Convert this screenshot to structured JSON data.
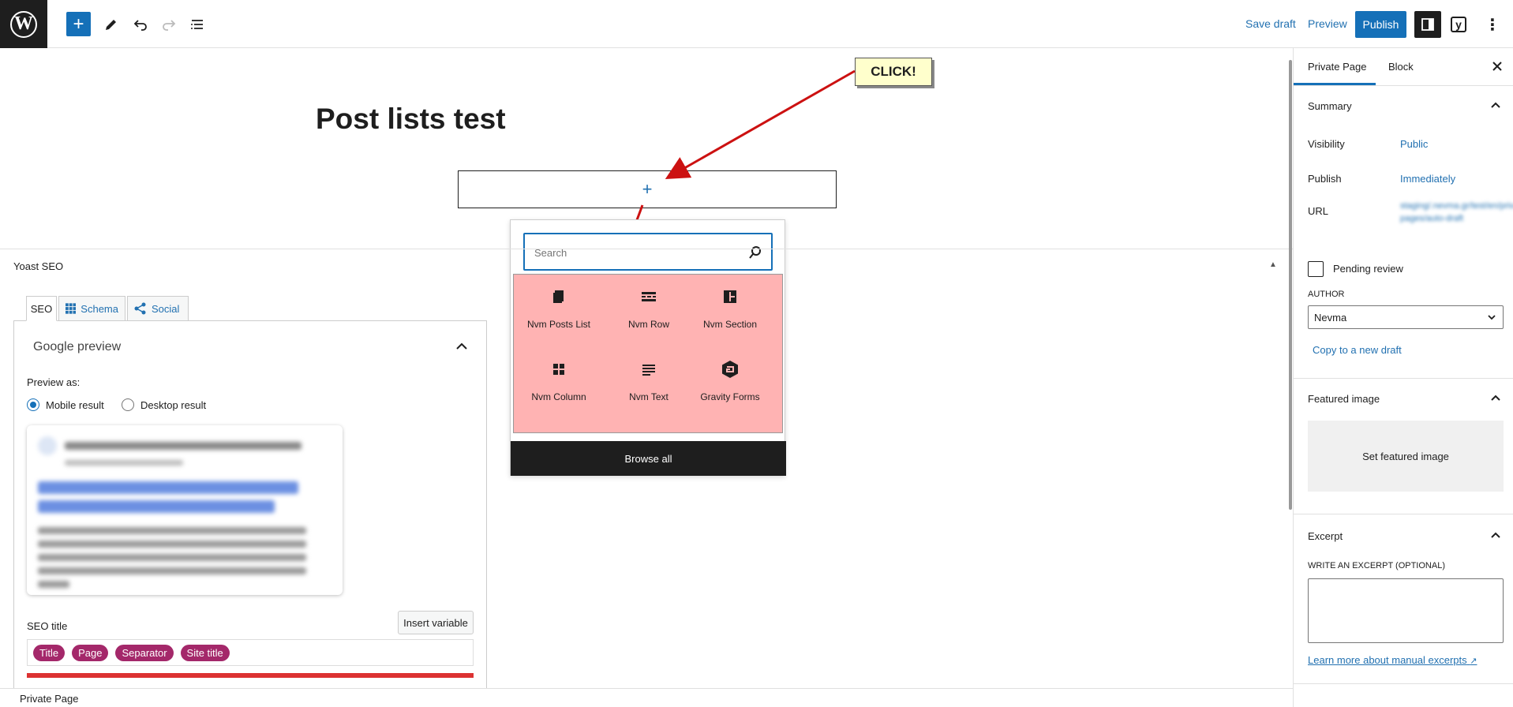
{
  "topbar": {
    "save_draft": "Save draft",
    "preview": "Preview",
    "publish": "Publish",
    "yoast_icon_label": "y",
    "more_icon": "more-vertical-icon",
    "accent_color": "#1570b8"
  },
  "editor": {
    "title": "Post lists test",
    "callout": "CLICK!",
    "appender_icon": "+"
  },
  "inserter": {
    "search_placeholder": "Search",
    "blocks": [
      {
        "label": "Nvm Posts List",
        "icon": "pages-icon"
      },
      {
        "label": "Nvm Row",
        "icon": "row-icon"
      },
      {
        "label": "Nvm Section",
        "icon": "section-icon"
      },
      {
        "label": "Nvm Column",
        "icon": "columns-icon"
      },
      {
        "label": "Nvm Text",
        "icon": "text-icon"
      },
      {
        "label": "Gravity Forms",
        "icon": "gravity-forms-icon"
      }
    ],
    "browse_all": "Browse all",
    "highlight_color": "#ffb3b3"
  },
  "yoast": {
    "title": "Yoast SEO",
    "tabs": [
      "SEO",
      "Schema",
      "Social"
    ],
    "google_preview": "Google preview",
    "preview_as": "Preview as:",
    "radio_mobile": "Mobile result",
    "radio_desktop": "Desktop result",
    "seo_title_label": "SEO title",
    "insert_variable": "Insert variable",
    "pills": [
      "Title",
      "Page",
      "Separator",
      "Site title"
    ],
    "pill_color": "#a4286a",
    "bar_color": "#dc3232"
  },
  "footer": {
    "breadcrumb": "Private Page"
  },
  "sidebar": {
    "tab_page": "Private Page",
    "tab_block": "Block",
    "summary": "Summary",
    "visibility_label": "Visibility",
    "visibility_value": "Public",
    "publish_label": "Publish",
    "publish_value": "Immediately",
    "url_label": "URL",
    "url_value": "staging/.nevma.gr/test/en/private-pages/auto-draft",
    "pending_review": "Pending review",
    "author_label": "AUTHOR",
    "author_value": "Nevma",
    "copy_draft": "Copy to a new draft",
    "featured_image": "Featured image",
    "set_featured": "Set featured image",
    "excerpt": "Excerpt",
    "excerpt_label": "WRITE AN EXCERPT (OPTIONAL)",
    "excerpt_link": "Learn more about manual excerpts"
  }
}
